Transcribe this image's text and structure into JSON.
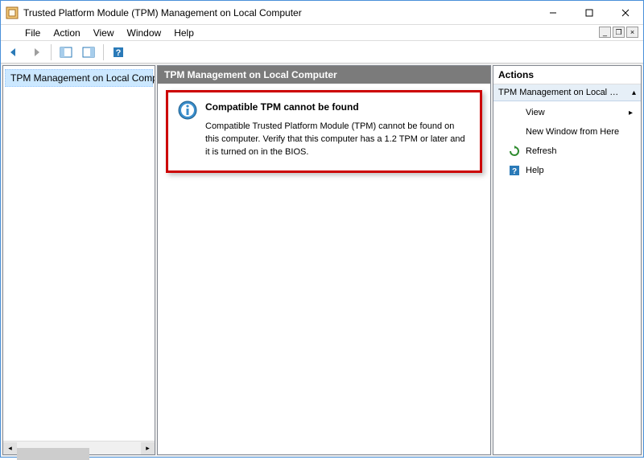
{
  "window": {
    "title": "Trusted Platform Module (TPM) Management on Local Computer"
  },
  "menubar": [
    "File",
    "Action",
    "View",
    "Window",
    "Help"
  ],
  "tree": {
    "item": "TPM Management on Local Comp"
  },
  "center": {
    "header": "TPM Management on Local Computer",
    "info_heading": "Compatible TPM cannot be found",
    "info_body": "Compatible Trusted Platform Module (TPM) cannot be found on this computer. Verify that this computer has a 1.2 TPM or later and it is turned on in the BIOS."
  },
  "actions": {
    "title": "Actions",
    "group": "TPM Management on Local Computer",
    "items": [
      {
        "label": "View",
        "icon": "",
        "submenu": true
      },
      {
        "label": "New Window from Here",
        "icon": "",
        "submenu": false
      },
      {
        "label": "Refresh",
        "icon": "refresh",
        "submenu": false
      },
      {
        "label": "Help",
        "icon": "help",
        "submenu": false
      }
    ]
  }
}
